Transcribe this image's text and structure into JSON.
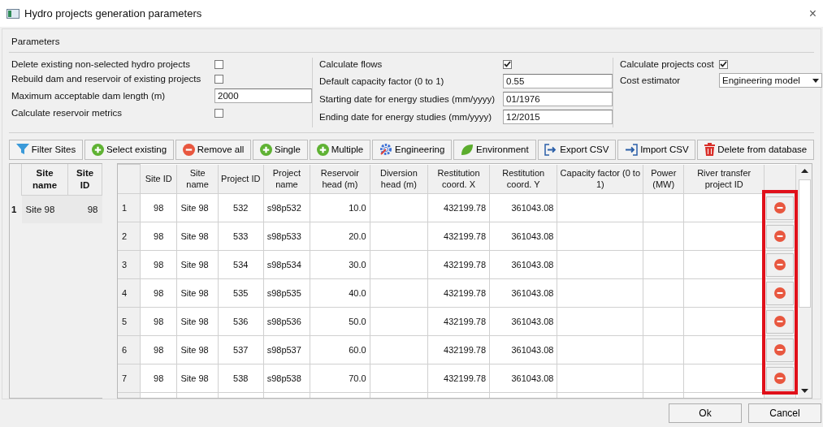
{
  "window": {
    "title": "Hydro projects generation parameters",
    "close": "×"
  },
  "parameters": {
    "title": "Parameters",
    "columns": [
      [
        {
          "kind": "checkbox",
          "label": "Delete existing non-selected hydro projects",
          "checked": false
        },
        {
          "kind": "checkbox",
          "label": "Rebuild dam and reservoir of existing projects",
          "checked": false
        },
        {
          "kind": "text",
          "label": "Maximum acceptable dam length (m)",
          "value": "2000"
        },
        {
          "kind": "checkbox",
          "label": "Calculate reservoir metrics",
          "checked": false
        }
      ],
      [
        {
          "kind": "checkbox",
          "label": "Calculate flows",
          "checked": true
        },
        {
          "kind": "text",
          "label": "Default capacity factor (0 to 1)",
          "value": "0.55"
        },
        {
          "kind": "text",
          "label": "Starting date for energy studies (mm/yyyy)",
          "value": "01/1976"
        },
        {
          "kind": "text",
          "label": "Ending date for energy studies (mm/yyyy)",
          "value": "12/2015"
        }
      ],
      [
        {
          "kind": "checkbox",
          "label": "Calculate projects cost",
          "checked": true
        },
        {
          "kind": "select",
          "label": "Cost estimator",
          "value": "Engineering model"
        }
      ]
    ]
  },
  "toolbar": [
    {
      "kind": "filter",
      "label": "Filter Sites"
    },
    {
      "kind": "add",
      "label": "Select existing"
    },
    {
      "kind": "remove",
      "label": "Remove all"
    },
    {
      "kind": "add",
      "label": "Single"
    },
    {
      "kind": "add",
      "label": "Multiple"
    },
    {
      "kind": "engineering",
      "label": "Engineering"
    },
    {
      "kind": "environment",
      "label": "Environment"
    },
    {
      "kind": "export",
      "label": "Export CSV"
    },
    {
      "kind": "import",
      "label": "Import CSV"
    },
    {
      "kind": "delete",
      "label": "Delete from database"
    }
  ],
  "sites_table": {
    "columns": [
      "Site name",
      "Site ID"
    ],
    "rows": [
      {
        "number": "1",
        "cells": [
          "Site 98",
          "98"
        ]
      }
    ]
  },
  "projects_table": {
    "columns": [
      "Site ID",
      "Site name",
      "Project ID",
      "Project name",
      "Reservoir head (m)",
      "Diversion head (m)",
      "Restitution coord. X",
      "Restitution coord. Y",
      "Capacity factor (0 to 1)",
      "Power (MW)",
      "River transfer project ID"
    ],
    "rows": [
      {
        "number": "1",
        "cells": [
          "98",
          "Site 98",
          "532",
          "s98p532",
          "10.0",
          "",
          "432199.78",
          "361043.08",
          "",
          "",
          ""
        ]
      },
      {
        "number": "2",
        "cells": [
          "98",
          "Site 98",
          "533",
          "s98p533",
          "20.0",
          "",
          "432199.78",
          "361043.08",
          "",
          "",
          ""
        ]
      },
      {
        "number": "3",
        "cells": [
          "98",
          "Site 98",
          "534",
          "s98p534",
          "30.0",
          "",
          "432199.78",
          "361043.08",
          "",
          "",
          ""
        ]
      },
      {
        "number": "4",
        "cells": [
          "98",
          "Site 98",
          "535",
          "s98p535",
          "40.0",
          "",
          "432199.78",
          "361043.08",
          "",
          "",
          ""
        ]
      },
      {
        "number": "5",
        "cells": [
          "98",
          "Site 98",
          "536",
          "s98p536",
          "50.0",
          "",
          "432199.78",
          "361043.08",
          "",
          "",
          ""
        ]
      },
      {
        "number": "6",
        "cells": [
          "98",
          "Site 98",
          "537",
          "s98p537",
          "60.0",
          "",
          "432199.78",
          "361043.08",
          "",
          "",
          ""
        ]
      },
      {
        "number": "7",
        "cells": [
          "98",
          "Site 98",
          "538",
          "s98p538",
          "70.0",
          "",
          "432199.78",
          "361043.08",
          "",
          "",
          ""
        ]
      }
    ]
  },
  "buttons": [
    "Ok",
    "Cancel"
  ]
}
